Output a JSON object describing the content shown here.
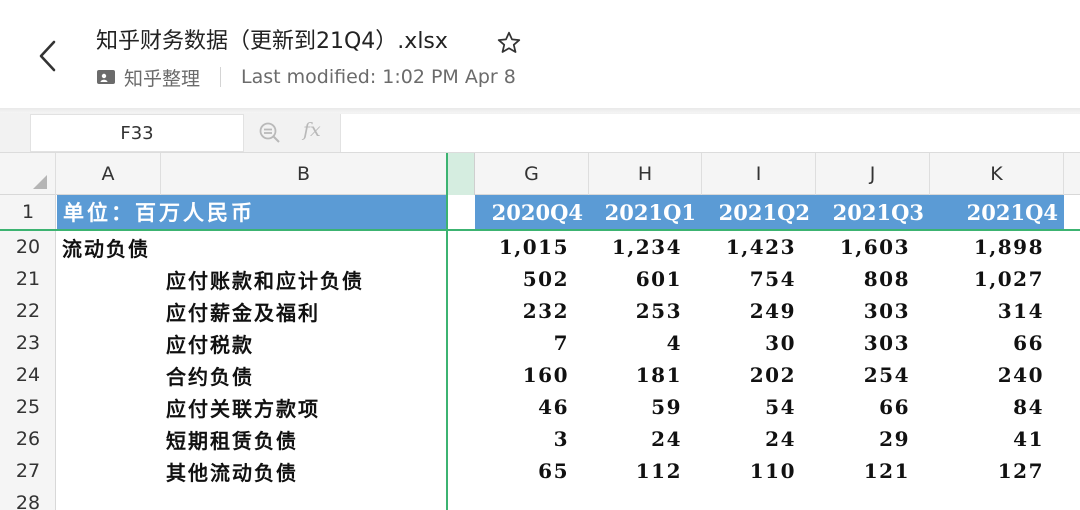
{
  "header": {
    "title": "知乎财务数据（更新到21Q4）.xlsx",
    "folder": "知乎整理",
    "last_modified": "Last modified: 1:02 PM Apr 8"
  },
  "formula_bar": {
    "cell_ref": "F33",
    "fx_label": "fx",
    "formula_value": ""
  },
  "columns": [
    "A",
    "B",
    "G",
    "H",
    "I",
    "J",
    "K"
  ],
  "sheet": {
    "header_row": {
      "row_num": "1",
      "label": "单位：百万人民币",
      "periods": [
        "2020Q4",
        "2021Q1",
        "2021Q2",
        "2021Q3",
        "2021Q4"
      ]
    },
    "rows": [
      {
        "row_num": "20",
        "label": "流动负债",
        "indent": false,
        "values": [
          "1,015",
          "1,234",
          "1,423",
          "1,603",
          "1,898"
        ]
      },
      {
        "row_num": "21",
        "label": "应付账款和应计负债",
        "indent": true,
        "values": [
          "502",
          "601",
          "754",
          "808",
          "1,027"
        ]
      },
      {
        "row_num": "22",
        "label": "应付薪金及福利",
        "indent": true,
        "values": [
          "232",
          "253",
          "249",
          "303",
          "314"
        ]
      },
      {
        "row_num": "23",
        "label": "应付税款",
        "indent": true,
        "values": [
          "7",
          "4",
          "30",
          "303",
          "66"
        ]
      },
      {
        "row_num": "24",
        "label": "合约负债",
        "indent": true,
        "values": [
          "160",
          "181",
          "202",
          "254",
          "240"
        ]
      },
      {
        "row_num": "25",
        "label": "应付关联方款项",
        "indent": true,
        "values": [
          "46",
          "59",
          "54",
          "66",
          "84"
        ]
      },
      {
        "row_num": "26",
        "label": "短期租赁负债",
        "indent": true,
        "values": [
          "3",
          "24",
          "24",
          "29",
          "41"
        ]
      },
      {
        "row_num": "27",
        "label": "其他流动负债",
        "indent": true,
        "values": [
          "65",
          "112",
          "110",
          "121",
          "127"
        ]
      }
    ],
    "partial_row_num": "28"
  },
  "colors": {
    "header_band": "#5b9bd5",
    "freeze_line": "#3cb371"
  }
}
